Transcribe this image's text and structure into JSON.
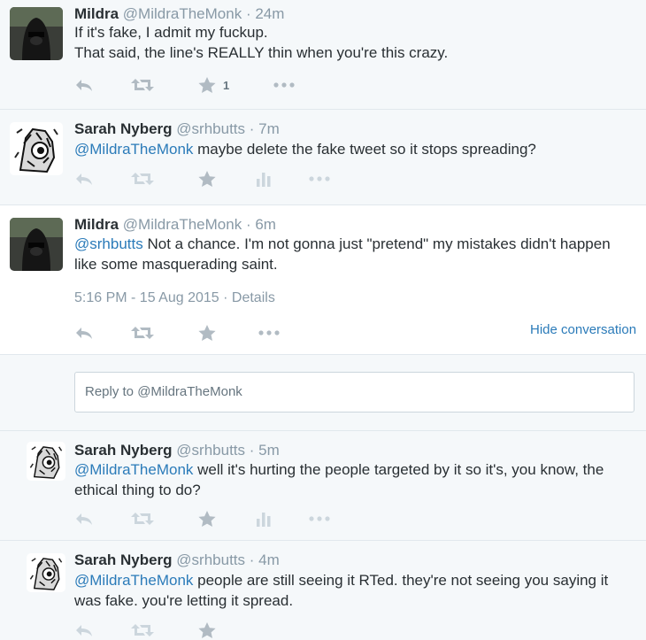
{
  "tweets": [
    {
      "name": "Mildra",
      "handle": "@MildraTheMonk",
      "time": "· 24m",
      "lines": [
        {
          "mention": "",
          "text": "If it's fake, I admit my fuckup."
        },
        {
          "mention": "",
          "text": "That said, the line's REALLY thin when you're this crazy."
        }
      ],
      "favorites_count": "1"
    },
    {
      "name": "Sarah Nyberg",
      "handle": "@srhbutts",
      "time": "· 7m",
      "lines": [
        {
          "mention": "@MildraTheMonk",
          "text": " maybe delete the fake tweet so it stops spreading?"
        }
      ]
    },
    {
      "name": "Mildra",
      "handle": "@MildraTheMonk",
      "time": "· 6m",
      "lines": [
        {
          "mention": "@srhbutts",
          "text": " Not a chance. I'm not gonna just \"pretend\" my mistakes didn't happen"
        },
        {
          "mention": "",
          "text": "like some masquerading saint."
        }
      ],
      "timestamp": "5:16 PM - 15 Aug 2015",
      "details_label": "Details",
      "separator": "·",
      "hide_conversation": "Hide conversation"
    },
    {
      "name": "Sarah Nyberg",
      "handle": "@srhbutts",
      "time": "· 5m",
      "lines": [
        {
          "mention": "@MildraTheMonk",
          "text": " well it's hurting the people targeted by it so it's, you know, the"
        },
        {
          "mention": "",
          "text": "ethical thing to do?"
        }
      ]
    },
    {
      "name": "Sarah Nyberg",
      "handle": "@srhbutts",
      "time": "· 4m",
      "lines": [
        {
          "mention": "@MildraTheMonk",
          "text": " people are still seeing it RTed. they're not seeing you saying it"
        },
        {
          "mention": "",
          "text": "was fake. you're letting it spread."
        }
      ]
    }
  ],
  "reply_box": {
    "placeholder": "Reply to @MildraTheMonk"
  },
  "colors": {
    "link": "#2b7bb9",
    "muted": "#8899a6",
    "icon": "#b1bbc3",
    "background": "#f5f8fa",
    "border": "#e1e8ed"
  },
  "icons": [
    "reply-icon",
    "retweet-icon",
    "favorite-icon",
    "analytics-icon",
    "more-icon"
  ]
}
